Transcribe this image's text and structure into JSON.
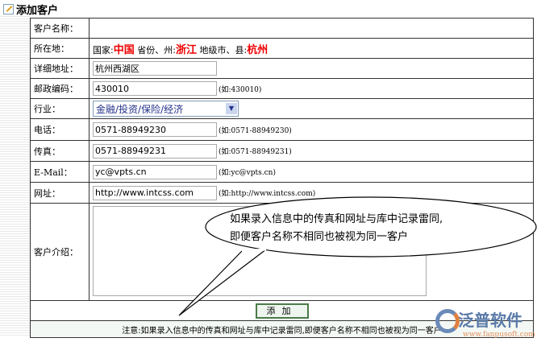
{
  "title": "添加客户",
  "form": {
    "name_label": "客户名称：",
    "location_label": "所在地：",
    "country_label": "国家:",
    "country": "中国",
    "province_label": "省份、州:",
    "province": "浙江",
    "city_label": "地级市、县:",
    "city": "杭州",
    "address_label": "详细地址：",
    "address": "杭州西湖区",
    "postal_label": "邮政编码：",
    "postal": "430010",
    "postal_hint": "(如:430010)",
    "industry_label": "行业：",
    "industry": "金融/投资/保险/经济",
    "phone_label": "电话：",
    "phone": "0571-88949230",
    "phone_hint": "(如:0571-88949230)",
    "fax_label": "传真：",
    "fax": "0571-88949231",
    "fax_hint": "(如:0571-88949231)",
    "email_label": "E-Mail：",
    "email": "yc@vpts.cn",
    "email_hint": "(如:yc@vpts.cn)",
    "url_label": "网址：",
    "url": "http://www.intcss.com",
    "url_hint": "(如:http://www.intcss.com)",
    "intro_label": "客户介绍：",
    "add_button": "添加",
    "note": "注意:如果录入信息中的传真和网址与库中记录雷同,即便客户名称不相同也被视为同一客户"
  },
  "callout": {
    "line1": "如果录入信息中的传真和网址与库中记录雷同,",
    "line2": "即便客户名称不相同也被视为同一客户"
  },
  "logo": {
    "name": "泛普软件",
    "url": "www.fanpusoft.com"
  }
}
